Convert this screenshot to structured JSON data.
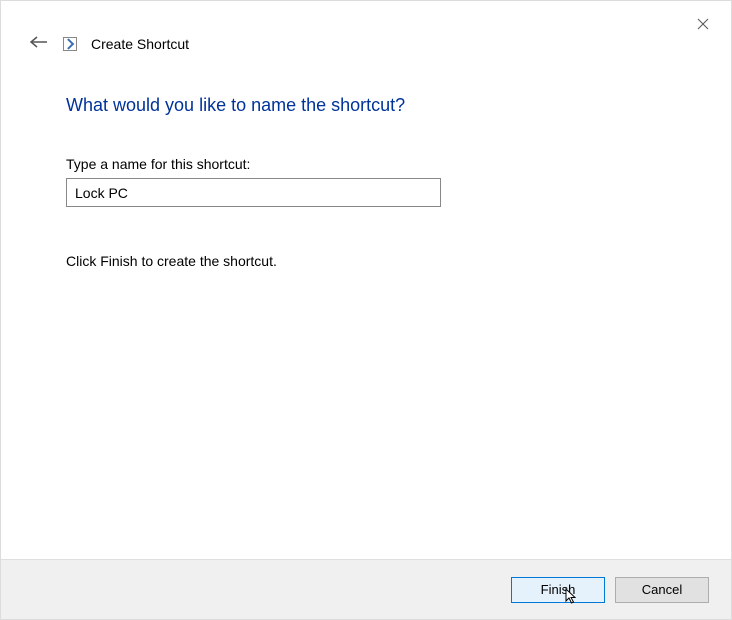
{
  "window": {
    "title": "Create Shortcut"
  },
  "content": {
    "heading": "What would you like to name the shortcut?",
    "label": "Type a name for this shortcut:",
    "input_value": "Lock PC",
    "instruction": "Click Finish to create the shortcut."
  },
  "footer": {
    "primary_button": "Finish",
    "cancel_button": "Cancel"
  }
}
